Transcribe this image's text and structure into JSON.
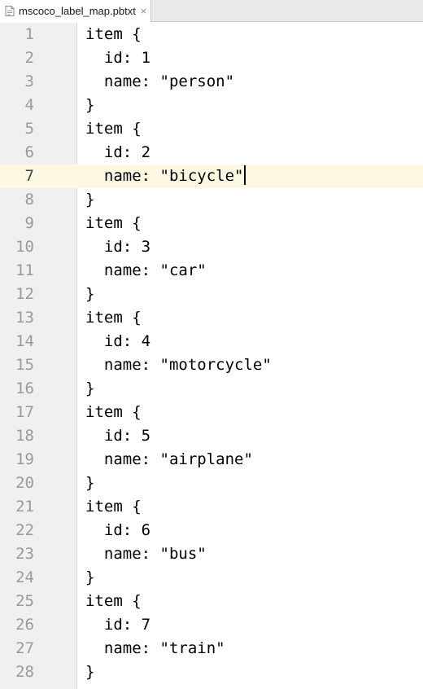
{
  "tab": {
    "title": "mscoco_label_map.pbtxt",
    "close_glyph": "×",
    "icon": "text-file-icon"
  },
  "editor": {
    "current_line": 7,
    "lines": [
      {
        "num": "1",
        "text": "item {"
      },
      {
        "num": "2",
        "text": "  id: 1"
      },
      {
        "num": "3",
        "text": "  name: \"person\""
      },
      {
        "num": "4",
        "text": "}"
      },
      {
        "num": "5",
        "text": "item {"
      },
      {
        "num": "6",
        "text": "  id: 2"
      },
      {
        "num": "7",
        "text": "  name: \"bicycle\""
      },
      {
        "num": "8",
        "text": "}"
      },
      {
        "num": "9",
        "text": "item {"
      },
      {
        "num": "10",
        "text": "  id: 3"
      },
      {
        "num": "11",
        "text": "  name: \"car\""
      },
      {
        "num": "12",
        "text": "}"
      },
      {
        "num": "13",
        "text": "item {"
      },
      {
        "num": "14",
        "text": "  id: 4"
      },
      {
        "num": "15",
        "text": "  name: \"motorcycle\""
      },
      {
        "num": "16",
        "text": "}"
      },
      {
        "num": "17",
        "text": "item {"
      },
      {
        "num": "18",
        "text": "  id: 5"
      },
      {
        "num": "19",
        "text": "  name: \"airplane\""
      },
      {
        "num": "20",
        "text": "}"
      },
      {
        "num": "21",
        "text": "item {"
      },
      {
        "num": "22",
        "text": "  id: 6"
      },
      {
        "num": "23",
        "text": "  name: \"bus\""
      },
      {
        "num": "24",
        "text": "}"
      },
      {
        "num": "25",
        "text": "item {"
      },
      {
        "num": "26",
        "text": "  id: 7"
      },
      {
        "num": "27",
        "text": "  name: \"train\""
      },
      {
        "num": "28",
        "text": "}"
      }
    ]
  },
  "colors": {
    "current_line_bg": "#fdf8e1",
    "gutter_bg": "#f0f0f0",
    "line_number": "#9a9a9a"
  }
}
